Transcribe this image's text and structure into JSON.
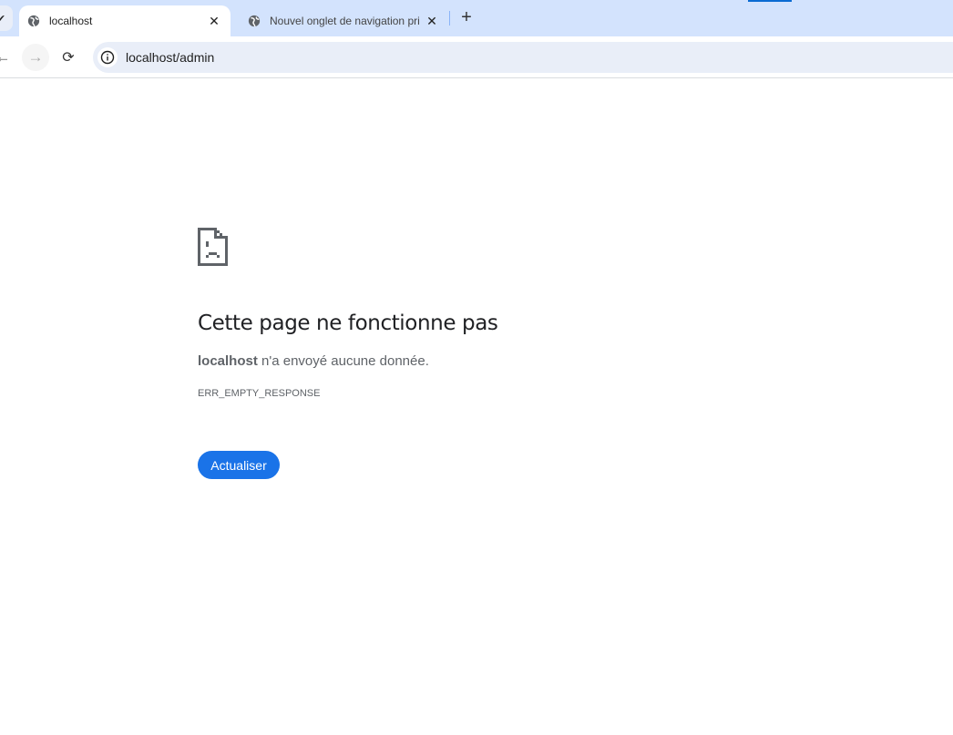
{
  "tabs": [
    {
      "title": "localhost",
      "active": true
    },
    {
      "title": "Nouvel onglet de navigation pri",
      "active": false
    }
  ],
  "toolbar": {
    "url": "localhost/admin"
  },
  "error": {
    "title": "Cette page ne fonctionne pas",
    "host": "localhost",
    "message": " n'a envoyé aucune donnée.",
    "code": "ERR_EMPTY_RESPONSE",
    "reload_label": "Actualiser"
  },
  "colors": {
    "accent": "#1a73e8",
    "tabstrip": "#d3e3fd",
    "omnibox": "#e9eef8"
  }
}
